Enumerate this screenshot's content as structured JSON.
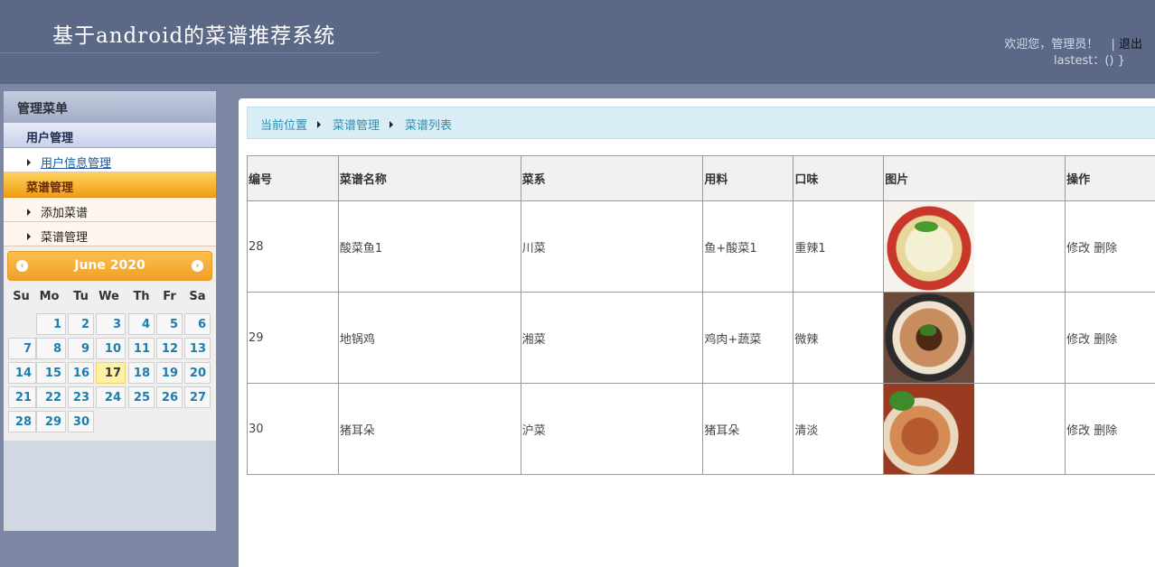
{
  "header": {
    "site_title": "基于android的菜谱推荐系统",
    "welcome": "欢迎您，管理员！",
    "separator": "|",
    "logout": "退出",
    "lastest": "lastest：() }"
  },
  "sidebar": {
    "title": "管理菜单",
    "groups": [
      {
        "label": "用户管理",
        "items": [
          {
            "label": "用户信息管理"
          }
        ]
      },
      {
        "label": "菜谱管理",
        "items": [
          {
            "label": "添加菜谱"
          },
          {
            "label": "菜谱管理"
          }
        ]
      }
    ]
  },
  "calendar": {
    "month_label": "June 2020",
    "prev_icon": "‹",
    "next_icon": "›",
    "weekdays": [
      "Su",
      "Mo",
      "Tu",
      "We",
      "Th",
      "Fr",
      "Sa"
    ],
    "days": [
      "1",
      "2",
      "3",
      "4",
      "5",
      "6",
      "7",
      "8",
      "9",
      "10",
      "11",
      "12",
      "13",
      "14",
      "15",
      "16",
      "17",
      "18",
      "19",
      "20",
      "21",
      "22",
      "23",
      "24",
      "25",
      "26",
      "27",
      "28",
      "29",
      "30"
    ],
    "today": "17"
  },
  "breadcrumb": {
    "items": [
      "当前位置",
      "菜谱管理",
      "菜谱列表"
    ]
  },
  "table": {
    "headers": [
      "编号",
      "菜谱名称",
      "菜系",
      "用料",
      "口味",
      "图片",
      "操作"
    ],
    "rows": [
      {
        "id": "28",
        "name": "酸菜鱼1",
        "cuisine": "川菜",
        "ingredients": "鱼+酸菜1",
        "taste": "重辣1",
        "edit": "修改",
        "delete": "删除"
      },
      {
        "id": "29",
        "name": "地锅鸡",
        "cuisine": "湘菜",
        "ingredients": "鸡肉+蔬菜",
        "taste": "微辣",
        "edit": "修改",
        "delete": "删除"
      },
      {
        "id": "30",
        "name": "猪耳朵",
        "cuisine": "沪菜",
        "ingredients": "猪耳朵",
        "taste": "清淡",
        "edit": "修改",
        "delete": "删除"
      }
    ]
  },
  "colors": {
    "header_bg": "#5b6886",
    "accent_orange": "#f1a027",
    "link_blue": "#2a8fb3",
    "breadcrumb_bg": "#d8edf6"
  }
}
